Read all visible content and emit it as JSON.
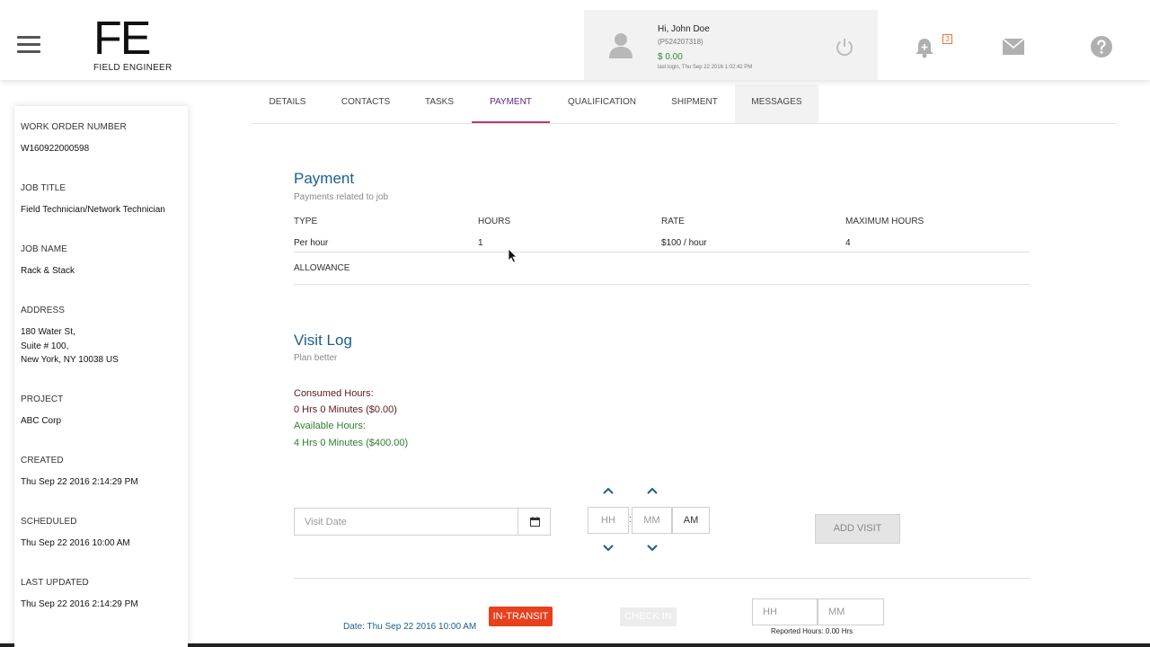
{
  "header": {
    "logo_mark": "FE",
    "logo_sub": "FIELD ENGINEER",
    "faint_topbar": "",
    "user": {
      "greeting": "Hi, John Doe",
      "id": "(P524207318)",
      "balance": "$ 0.00",
      "last_login": "last login, Thu Sep 22 2016 1:02:42 PM"
    },
    "notification_count": "3"
  },
  "sidebar": {
    "fields": [
      {
        "label": "WORK ORDER NUMBER",
        "value": "W160922000598"
      },
      {
        "label": "JOB TITLE",
        "value": "Field Technician/Network Technician"
      },
      {
        "label": "JOB NAME",
        "value": "Rack & Stack"
      },
      {
        "label": "ADDRESS",
        "value_lines": [
          "180 Water St,",
          "Suite # 100,",
          "New York, NY 10038 US"
        ]
      },
      {
        "label": "PROJECT",
        "value": "ABC Corp"
      },
      {
        "label": "CREATED",
        "value": "Thu Sep 22 2016 2:14:29 PM"
      },
      {
        "label": "SCHEDULED",
        "value": "Thu Sep 22 2016 10:00 AM"
      },
      {
        "label": "LAST UPDATED",
        "value": "Thu Sep 22 2016 2:14:29 PM"
      }
    ]
  },
  "tabs": [
    {
      "label": "DETAILS",
      "active": false
    },
    {
      "label": "CONTACTS",
      "active": false
    },
    {
      "label": "TASKS",
      "active": false
    },
    {
      "label": "PAYMENT",
      "active": true
    },
    {
      "label": "QUALIFICATION",
      "active": false
    },
    {
      "label": "SHIPMENT",
      "active": false
    },
    {
      "label": "MESSAGES",
      "active": false
    }
  ],
  "payment": {
    "title": "Payment",
    "subtitle": "Payments related to job",
    "columns": [
      "TYPE",
      "HOURS",
      "RATE",
      "MAXIMUM HOURS"
    ],
    "row": [
      "Per hour",
      "1",
      "$100 / hour",
      "4"
    ],
    "allowance_label": "ALLOWANCE"
  },
  "visit_log": {
    "title": "Visit Log",
    "subtitle": "Plan better",
    "consumed_label": "Consumed Hours:",
    "consumed_value": "0 Hrs 0 Minutes ($0.00)",
    "available_label": "Available Hours:",
    "available_value": "4 Hrs 0 Minutes ($400.00)",
    "date_placeholder": "Visit Date",
    "hh_placeholder": "HH",
    "mm_placeholder": "MM",
    "ampm": "AM",
    "add_visit": "ADD VISIT",
    "entry": {
      "date": "Date: Thu Sep 22 2016 10:00 AM",
      "status": "IN-TRANSIT",
      "check_in": "CHECK IN",
      "hh_placeholder": "HH",
      "mm_placeholder": "MM",
      "reported": "Reported Hours: 0.00 Hrs"
    }
  },
  "colors": {
    "accent_title": "#1b5f8c",
    "active_tab": "#5a2a82",
    "active_underline": "#b23c72",
    "status_red": "#e8401c",
    "green": "#2e7d2e"
  }
}
